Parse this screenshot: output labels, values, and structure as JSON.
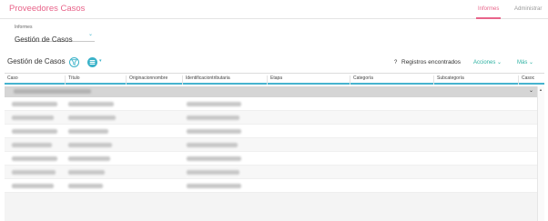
{
  "app": {
    "title": "Proveedores Casos"
  },
  "top_tabs": [
    {
      "label": "Informes",
      "active": true
    },
    {
      "label": "Administrar",
      "active": false
    }
  ],
  "report_picker": {
    "label": "Informes",
    "value": "Gestión de Casos"
  },
  "toolbar": {
    "section_title": "Gestión de Casos",
    "help_icon": "?",
    "records_text": "Registros encontrados",
    "actions_label": "Acciones",
    "more_label": "Más"
  },
  "grid": {
    "columns": [
      "Caso",
      "Título",
      "Originacionnombre",
      "Identificaciontributaria",
      "Etapa",
      "Categoría",
      "Subcategoría",
      "Casoc"
    ]
  },
  "colors": {
    "brand": "#e8648a",
    "accent": "#3ab2c9",
    "link": "#2bb0a0"
  },
  "icons": {
    "filter": "filter-icon",
    "view": "view-icon",
    "chevron": "chevron-down-icon"
  }
}
